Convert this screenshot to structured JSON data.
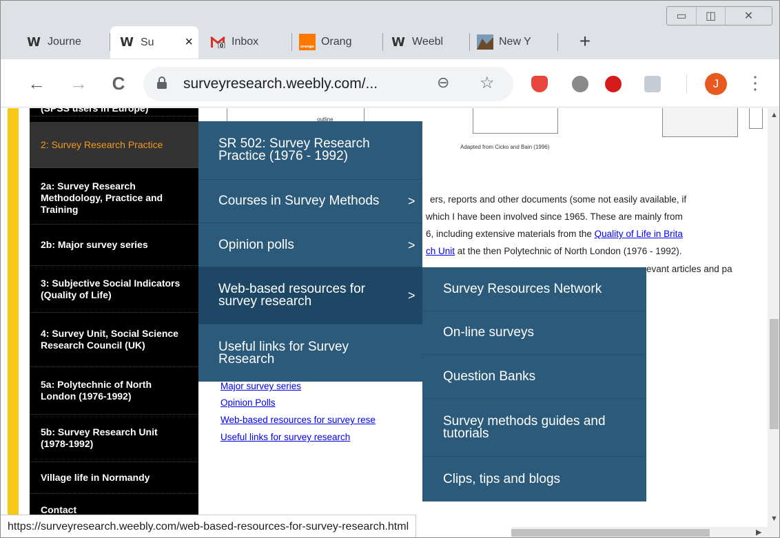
{
  "tabs": [
    {
      "label": "Journe",
      "icon": "weebly-icon",
      "active": false
    },
    {
      "label": "Su",
      "icon": "weebly-icon",
      "active": true,
      "close": "×"
    },
    {
      "label": "Inbox",
      "icon": "gmail-icon",
      "active": false
    },
    {
      "label": "Orang",
      "icon": "orange-icon",
      "active": false
    },
    {
      "label": "Weebl",
      "icon": "weebly-icon",
      "active": false
    },
    {
      "label": "New Y",
      "icon": "new-york-icon",
      "active": false
    }
  ],
  "new_tab": "+",
  "window_controls": {
    "minimize": "▭",
    "maximize": "◫",
    "close": "✕"
  },
  "toolbar": {
    "back": "←",
    "forward": "→",
    "reload": "C",
    "url": "surveyresearch.weebly.com/...",
    "zoom": "⊖",
    "star": "☆",
    "profile_initial": "J",
    "menu": "⋮"
  },
  "sidebar": {
    "items": [
      {
        "label": "(SPSS users in Europe)",
        "active": false
      },
      {
        "label": "2: Survey Research Practice",
        "active": true
      },
      {
        "label": "2a: Survey Research Methodology, Practice and Training",
        "active": false
      },
      {
        "label": "2b: Major survey series",
        "active": false
      },
      {
        "label": "3: Subjective Social Indicators (Quality of Life)",
        "active": false
      },
      {
        "label": "4: Survey Unit, Social Science Research Council (UK)",
        "active": false
      },
      {
        "label": "5a: Polytechnic of North London (1976-1992)",
        "active": false
      },
      {
        "label": "5b: Survey Research Unit (1978-1992)",
        "active": false
      },
      {
        "label": "Village life in Normandy",
        "active": false
      },
      {
        "label": "Contact",
        "active": false
      }
    ]
  },
  "page": {
    "box_caption_small": "outline",
    "image_caption": "Adapted from Cicko and Bain (1996)",
    "para": [
      "ers, reports and other documents (some not easily available, if",
      "which I have been involved since 1965.  These are mainly from",
      "6, including extensive materials from the ",
      "Quality of Life in Brita",
      "ch Unit",
      " at the then Polytechnic of North London (1976 - 1992).",
      "evant articles and pa"
    ],
    "links": [
      "Major survey series",
      "Opinion Polls",
      "Web-based resources for survey rese",
      "Useful links for survey research"
    ]
  },
  "menu1": {
    "items": [
      {
        "label": "SR 502: Survey Research Practice (1976 - 1992)",
        "arrow": ""
      },
      {
        "label": "Courses in Survey Methods",
        "arrow": ">"
      },
      {
        "label": "Opinion polls",
        "arrow": ">"
      },
      {
        "label": "Web-based resources for survey research",
        "arrow": ">"
      },
      {
        "label": "Useful links for Survey Research",
        "arrow": ""
      }
    ]
  },
  "menu2": {
    "items": [
      {
        "label": "Survey Resources Network"
      },
      {
        "label": "On-line surveys"
      },
      {
        "label": "Question Banks"
      },
      {
        "label": "Survey methods guides and tutorials"
      },
      {
        "label": "Clips, tips and blogs"
      }
    ]
  },
  "status_url": "https://surveyresearch.weebly.com/web-based-resources-for-survey-research.html",
  "colors": {
    "menu_bg": "#2b5a7a",
    "sidebar_bg": "#000000",
    "active_item": "#f29a1e",
    "accent_strip": "#f6c91a",
    "profile": "#e8591f"
  }
}
